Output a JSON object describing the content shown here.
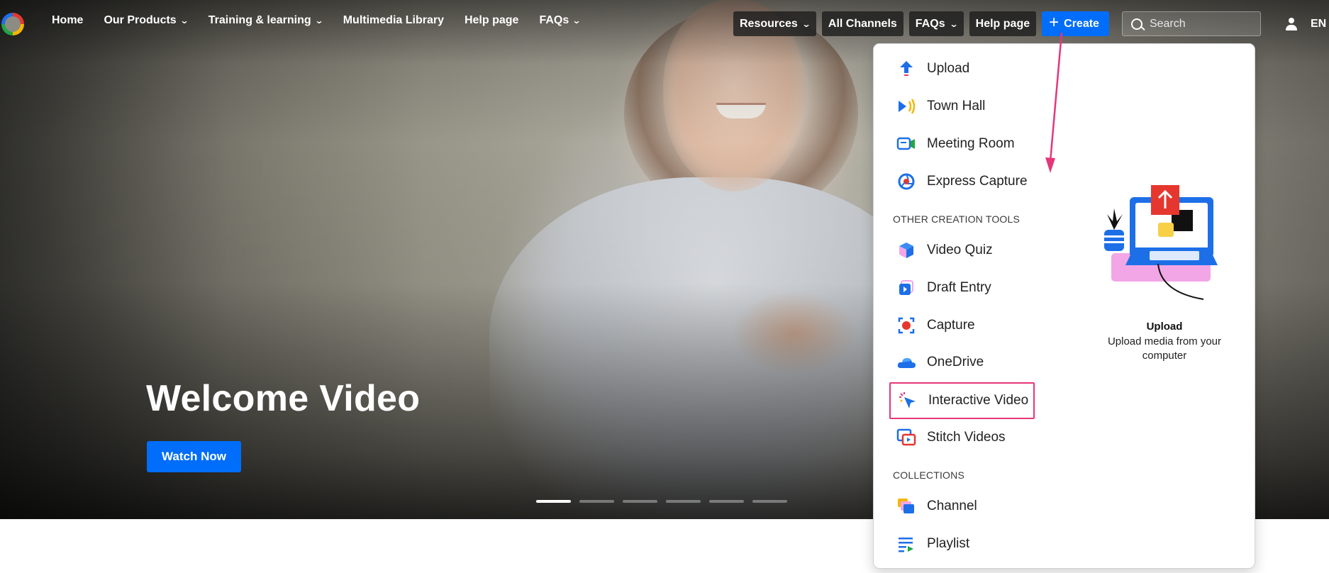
{
  "nav": {
    "links": [
      {
        "label": "Home",
        "dropdown": false
      },
      {
        "label": "Our Products",
        "dropdown": true
      },
      {
        "label": "Training & learning",
        "dropdown": true
      },
      {
        "label": "Multimedia Library",
        "dropdown": false
      },
      {
        "label": "Help page",
        "dropdown": false
      },
      {
        "label": "FAQs",
        "dropdown": true
      }
    ],
    "right": {
      "resources": "Resources",
      "all_channels": "All Channels",
      "faqs": "FAQs",
      "help": "Help page",
      "create": "Create",
      "search_placeholder": "Search",
      "language": "EN"
    }
  },
  "hero": {
    "title": "Welcome Video",
    "button": "Watch Now",
    "slides_total": 6,
    "active_slide": 1
  },
  "create_menu": {
    "primary": [
      {
        "label": "Upload",
        "icon": "upload-arrow-icon"
      },
      {
        "label": "Town Hall",
        "icon": "broadcast-icon"
      },
      {
        "label": "Meeting Room",
        "icon": "meeting-room-icon"
      },
      {
        "label": "Express Capture",
        "icon": "express-capture-icon"
      }
    ],
    "other_heading": "OTHER CREATION TOOLS",
    "other": [
      {
        "label": "Video Quiz",
        "icon": "video-quiz-icon"
      },
      {
        "label": "Draft Entry",
        "icon": "draft-entry-icon"
      },
      {
        "label": "Capture",
        "icon": "capture-record-icon"
      },
      {
        "label": "OneDrive",
        "icon": "onedrive-cloud-icon"
      },
      {
        "label": "Interactive Video",
        "icon": "interactive-cursor-icon",
        "highlighted": true
      },
      {
        "label": "Stitch Videos",
        "icon": "stitch-videos-icon"
      }
    ],
    "collections_heading": "COLLECTIONS",
    "collections": [
      {
        "label": "Channel",
        "icon": "channel-icon"
      },
      {
        "label": "Playlist",
        "icon": "playlist-icon"
      }
    ],
    "preview": {
      "title": "Upload",
      "description": "Upload media from your computer"
    }
  },
  "colors": {
    "primary_blue": "#006efa",
    "highlight_pink": "#e5367a",
    "nav_pill": "#1e1e1e"
  }
}
